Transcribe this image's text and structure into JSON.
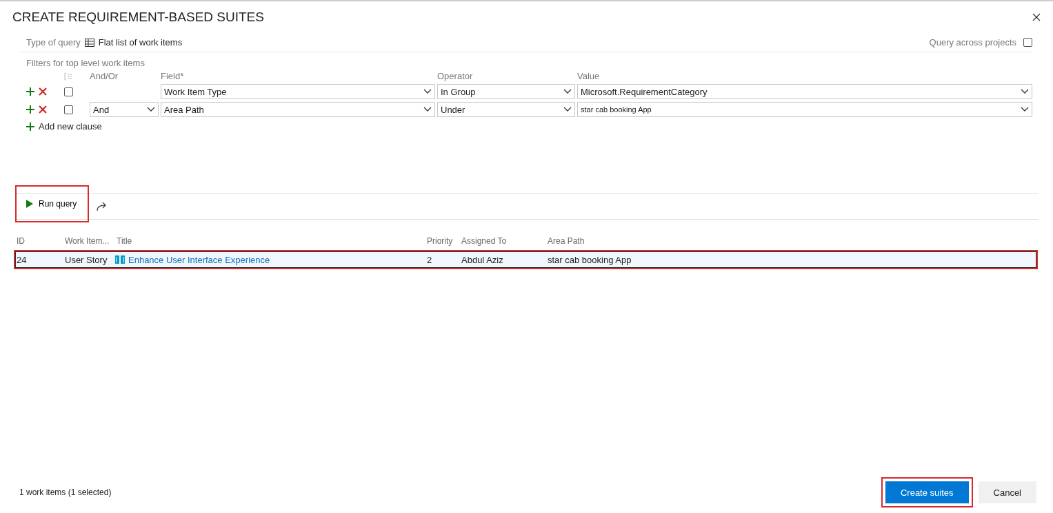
{
  "dialog": {
    "title": "CREATE REQUIREMENT-BASED SUITES"
  },
  "query_type": {
    "label": "Type of query",
    "value": "Flat list of work items"
  },
  "query_across_projects": {
    "label": "Query across projects",
    "checked": false
  },
  "filters_label": "Filters for top level work items",
  "clause_columns": [
    "And/Or",
    "Field*",
    "Operator",
    "Value"
  ],
  "clauses": [
    {
      "checked": false,
      "field": "Work Item Type",
      "operator": "In Group",
      "value": "Microsoft.RequirementCategory"
    },
    {
      "checked": false,
      "and_or": "And",
      "field": "Area Path",
      "operator": "Under",
      "value": "star cab booking App"
    }
  ],
  "add_clause": "Add new clause",
  "run_query": {
    "label": "Run query",
    "highlighted": true
  },
  "results": {
    "columns": [
      "ID",
      "Work Item...",
      "Title",
      "Priority",
      "Assigned To",
      "Area Path"
    ],
    "rows": [
      {
        "id": "24",
        "type": "User Story",
        "title": "Enhance User Interface Experience",
        "priority": "2",
        "assigned_to": "Abdul Aziz",
        "area_path": "star cab booking App",
        "selected": true,
        "highlighted": true
      }
    ]
  },
  "status": "1 work items (1 selected)",
  "buttons": [
    {
      "label": "Create suites",
      "kind": "primary",
      "highlighted": true
    },
    {
      "label": "Cancel",
      "kind": "secondary",
      "highlighted": false
    }
  ]
}
